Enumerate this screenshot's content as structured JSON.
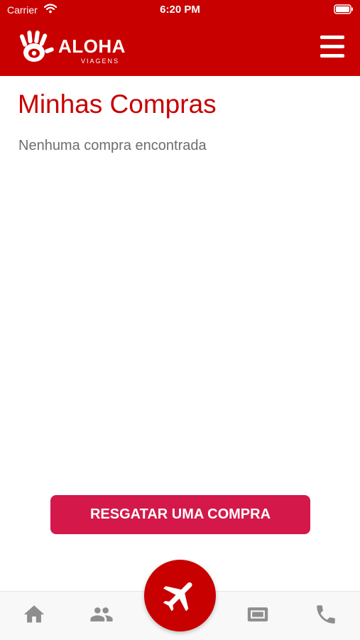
{
  "status_bar": {
    "carrier": "Carrier",
    "time": "6:20 PM"
  },
  "header": {
    "logo_text": "ALOHA",
    "logo_subtext": "VIAGENS"
  },
  "page": {
    "title": "Minhas Compras",
    "empty_message": "Nenhuma compra encontrada"
  },
  "actions": {
    "redeem_label": "RESGATAR UMA COMPRA"
  },
  "tab_bar": {
    "tabs": [
      {
        "icon": "home-icon"
      },
      {
        "icon": "people-icon"
      },
      {
        "icon": "airplane-icon",
        "active": true
      },
      {
        "icon": "ticket-icon"
      },
      {
        "icon": "phone-icon"
      }
    ]
  },
  "colors": {
    "brand_red": "#c80000",
    "button_pink": "#d4184a",
    "text_gray": "#6e6e6e",
    "tab_icon_gray": "#8e8e8e"
  }
}
